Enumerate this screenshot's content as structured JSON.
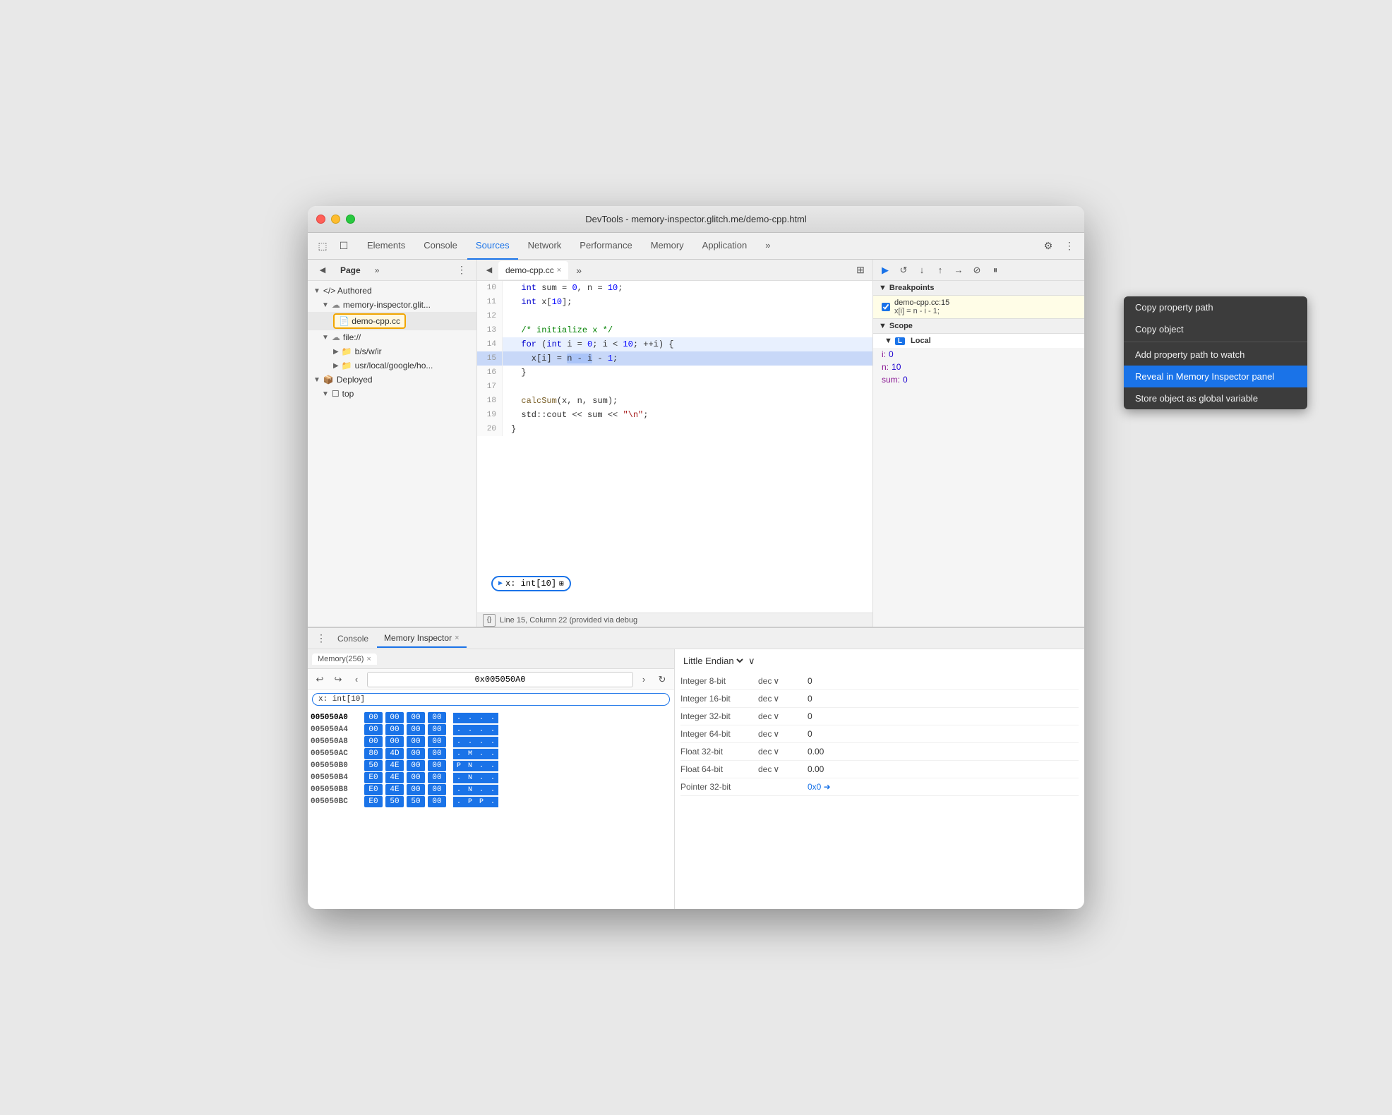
{
  "window": {
    "title": "DevTools - memory-inspector.glitch.me/demo-cpp.html"
  },
  "tabs": {
    "items": [
      "Elements",
      "Console",
      "Sources",
      "Network",
      "Performance",
      "Memory",
      "Application"
    ],
    "active": "Sources"
  },
  "left_panel": {
    "tab_label": "Page",
    "tree": [
      {
        "label": "</> Authored",
        "indent": 0,
        "type": "section"
      },
      {
        "label": "memory-inspector.glit...",
        "indent": 1,
        "type": "cloud"
      },
      {
        "label": "demo-cpp.cc",
        "indent": 2,
        "type": "file",
        "highlighted": true
      },
      {
        "label": "file://",
        "indent": 1,
        "type": "cloud"
      },
      {
        "label": "b/s/w/ir",
        "indent": 2,
        "type": "folder"
      },
      {
        "label": "usr/local/google/ho...",
        "indent": 2,
        "type": "folder"
      },
      {
        "label": "Deployed",
        "indent": 0,
        "type": "section"
      },
      {
        "label": "top",
        "indent": 1,
        "type": "box"
      }
    ]
  },
  "editor": {
    "filename": "demo-cpp.cc",
    "lines": [
      {
        "num": 10,
        "text": "  int sum = 0, n = 10;"
      },
      {
        "num": 11,
        "text": "  int x[10];"
      },
      {
        "num": 12,
        "text": ""
      },
      {
        "num": 13,
        "text": "  /* initialize x */"
      },
      {
        "num": 14,
        "text": "  for (int i = 0; i < 10; ++i) {"
      },
      {
        "num": 15,
        "text": "    x[i] = n - i - 1;",
        "active": true
      },
      {
        "num": 16,
        "text": "  }"
      },
      {
        "num": 17,
        "text": ""
      },
      {
        "num": 18,
        "text": "  calcSum(x, n, sum);"
      },
      {
        "num": 19,
        "text": "  std::cout << sum << \"\\n\";"
      },
      {
        "num": 20,
        "text": "}"
      }
    ],
    "status": "Line 15, Column 22 (provided via debug",
    "variable_popup": {
      "label": "x: int[10]",
      "arrow": "▶"
    }
  },
  "right_panel": {
    "breakpoints_label": "Breakpoints",
    "breakpoint": {
      "file": "demo-cpp.cc:15",
      "code": "x[i] = n - i - 1;"
    },
    "scope_label": "Scope",
    "local_label": "Local",
    "scope_vars": [
      {
        "key": "i:",
        "val": "0"
      },
      {
        "key": "n:",
        "val": "10"
      },
      {
        "key": "sum:",
        "val": "0"
      }
    ]
  },
  "bottom_panel": {
    "console_tab": "Console",
    "memory_tab": "Memory Inspector",
    "memory_tab_close": "×",
    "memory_header_tab": "Memory(256)",
    "address": "0x005050A0",
    "var_tag": "x: int[10]",
    "endian_label": "Little Endian",
    "hex_rows": [
      {
        "addr": "005050A0",
        "bold": true,
        "bytes": [
          "00",
          "00",
          "00",
          "00"
        ],
        "ascii": [
          ".",
          ".",
          ".",
          "..."
        ]
      },
      {
        "addr": "005050A4",
        "bold": false,
        "bytes": [
          "00",
          "00",
          "00",
          "00"
        ],
        "ascii": [
          ".",
          ".",
          ".",
          "..."
        ]
      },
      {
        "addr": "005050A8",
        "bold": false,
        "bytes": [
          "00",
          "00",
          "00",
          "00"
        ],
        "ascii": [
          ".",
          ".",
          ".",
          "..."
        ]
      },
      {
        "addr": "005050AC",
        "bold": false,
        "bytes": [
          "80",
          "4D",
          "00",
          "00"
        ],
        "ascii": [
          ".",
          "M",
          ".",
          "..."
        ]
      },
      {
        "addr": "005050B0",
        "bold": false,
        "bytes": [
          "50",
          "4E",
          "00",
          "00"
        ],
        "ascii": [
          "P",
          "N",
          ".",
          "..."
        ]
      },
      {
        "addr": "005050B4",
        "bold": false,
        "bytes": [
          "E0",
          "4E",
          "00",
          "00"
        ],
        "ascii": [
          ".",
          "N",
          ".",
          "..."
        ]
      },
      {
        "addr": "005050B8",
        "bold": false,
        "bytes": [
          "E0",
          "4E",
          "00",
          "00"
        ],
        "ascii": [
          ".",
          "N",
          ".",
          "..."
        ]
      },
      {
        "addr": "005050BC",
        "bold": false,
        "bytes": [
          "E0",
          "50",
          "50",
          "00"
        ],
        "ascii": [
          ".",
          "P",
          "P",
          "...."
        ]
      }
    ],
    "data_types": [
      {
        "label": "Integer 8-bit",
        "format": "dec",
        "value": "0"
      },
      {
        "label": "Integer 16-bit",
        "format": "dec",
        "value": "0"
      },
      {
        "label": "Integer 32-bit",
        "format": "dec",
        "value": "0"
      },
      {
        "label": "Integer 64-bit",
        "format": "dec",
        "value": "0"
      },
      {
        "label": "Float 32-bit",
        "format": "dec",
        "value": "0.00"
      },
      {
        "label": "Float 64-bit",
        "format": "dec",
        "value": "0.00"
      },
      {
        "label": "Pointer 32-bit",
        "format": "",
        "value": "0x0"
      }
    ]
  },
  "context_menu": {
    "items": [
      {
        "label": "Copy property path",
        "type": "item"
      },
      {
        "label": "Copy object",
        "type": "item"
      },
      {
        "label": "",
        "type": "divider"
      },
      {
        "label": "Add property path to watch",
        "type": "item"
      },
      {
        "label": "Reveal in Memory Inspector panel",
        "type": "item",
        "active": true
      },
      {
        "label": "Store object as global variable",
        "type": "item"
      }
    ]
  }
}
